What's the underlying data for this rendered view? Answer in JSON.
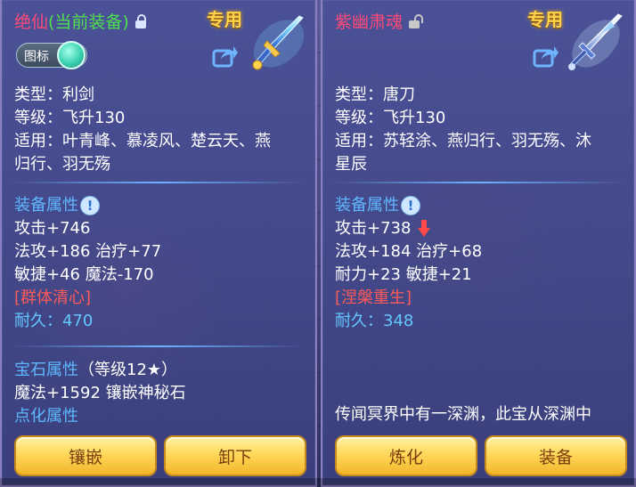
{
  "left_panel": {
    "title": "绝仙",
    "title_sub": "(当前装备)",
    "exclusive": "专用",
    "toggle_label": "图标",
    "type": "类型：利剑",
    "level": "等级：飞升130",
    "applicable_1": "适用：叶青峰、慕凌风、楚云天、燕",
    "applicable_2": "归行、羽无殇",
    "attr_head": "装备属性",
    "attack": "攻击+746",
    "magic_heal": "法攻+186 治疗+77",
    "agility_mana": "敏捷+46 魔法-170",
    "skill": "[群体清心]",
    "durability_label": "耐久：",
    "durability_value": "470",
    "gem_head": "宝石属性",
    "gem_level": "（等级12★）",
    "gem_stats": "魔法+1592 镶嵌神秘石",
    "refine_head": "点化属性",
    "buttons": [
      "镶嵌",
      "卸下"
    ]
  },
  "right_panel": {
    "title": "紫幽肃魂",
    "exclusive": "专用",
    "type": "类型：唐刀",
    "level": "等级：飞升130",
    "applicable_1": "适用：苏轻涂、燕归行、羽无殇、沐",
    "applicable_2": "星辰",
    "attr_head": "装备属性",
    "attack": "攻击+738",
    "magic_heal": "法攻+184 治疗+68",
    "stamina_agility": "耐力+23 敏捷+21",
    "skill": "[涅槃重生]",
    "durability_label": "耐久：",
    "durability_value": "348",
    "lore": "传闻冥界中有一深渊，此宝从深渊中",
    "buttons": [
      "炼化",
      "装备"
    ]
  },
  "colors": {
    "title_red": "#ff4a78",
    "current_green": "#4ee04e",
    "exclusive_gold": "#ffd34a",
    "attr_blue": "#5fb8ff",
    "skill_red": "#ff5a5a",
    "durability_cyan": "#63c7ff",
    "button_gold": "#ffd85a"
  },
  "icons": [
    "lock-closed-icon",
    "lock-open-icon",
    "share-icon",
    "sword-icon",
    "blade-icon",
    "info-icon",
    "down-arrow-icon"
  ]
}
